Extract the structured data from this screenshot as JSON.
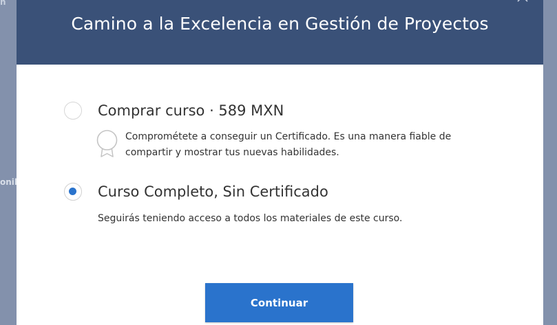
{
  "modal": {
    "title": "Camino a la Excelencia en Gestión de Proyectos"
  },
  "options": [
    {
      "title": "Comprar curso · 589 MXN",
      "description": "Comprométete a conseguir un Certificado. Es una manera fiable de compartir y mostrar tus nuevas habilidades.",
      "icon": "certificate-badge-icon",
      "selected": false
    },
    {
      "title": "Curso Completo, Sin Certificado",
      "description": "Seguirás teniendo acceso a todos los materiales de este curso.",
      "selected": true
    }
  ],
  "actions": {
    "continue_label": "Continuar"
  },
  "backdrop": {
    "fragment_top": "n",
    "fragment_mid": "onil"
  },
  "colors": {
    "header_bg": "#3a5178",
    "accent": "#2a73cc",
    "overlay": "#7f8ea9",
    "text": "#333333"
  }
}
